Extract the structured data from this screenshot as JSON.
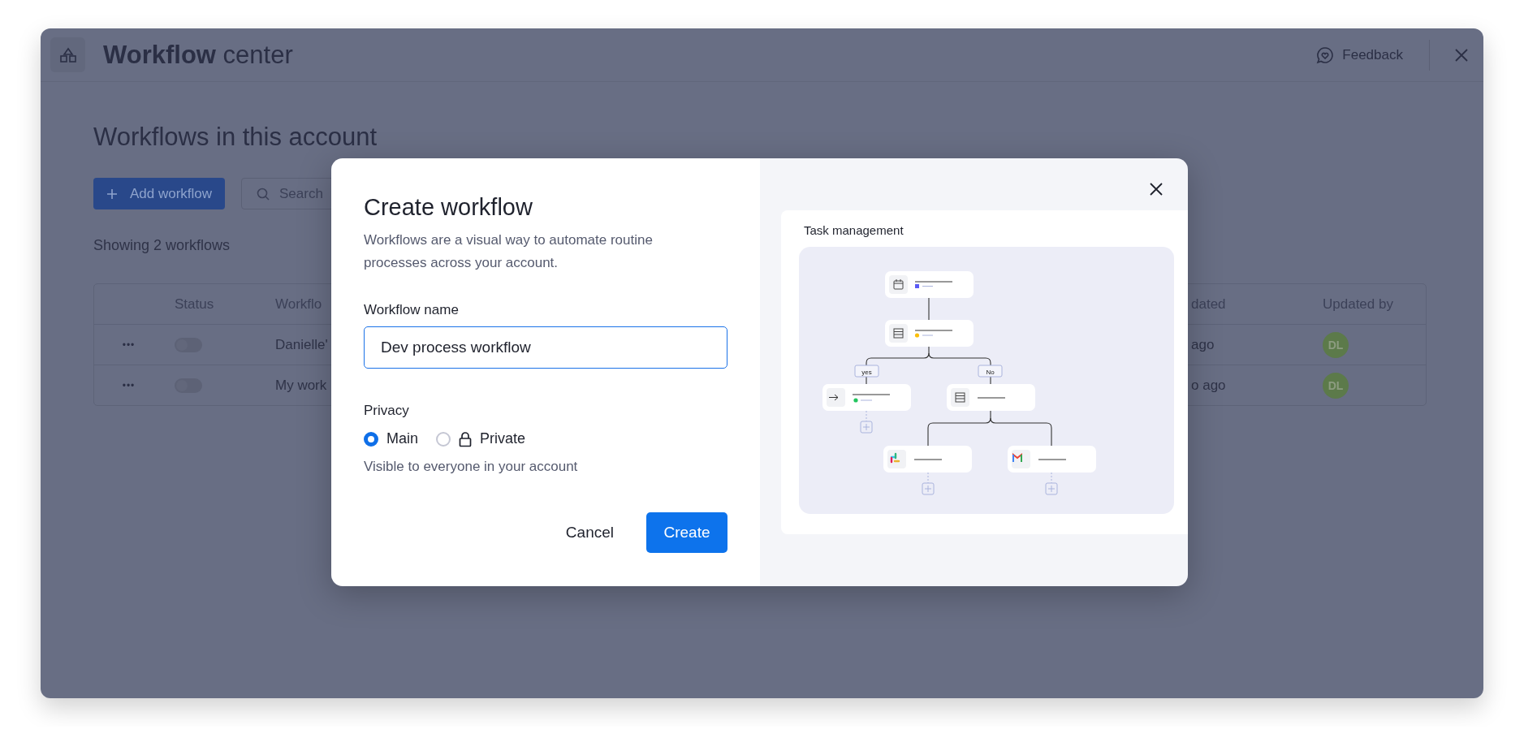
{
  "app": {
    "title": "**Workflow** center",
    "feedback": "Feedback"
  },
  "page": {
    "heading": "Workflows in this account",
    "add_button": "Add workflow",
    "search_placeholder": "Search",
    "count": "Showing 2 workflows"
  },
  "table": {
    "columns": [
      "",
      "Status",
      "Workflo",
      "dated",
      "Updated by"
    ],
    "rows": [
      {
        "menu": "•••",
        "on": false,
        "name": "Danielle'",
        "updated": "ago",
        "updated_by": "DL"
      },
      {
        "menu": "•••",
        "on": false,
        "name": "My work",
        "updated": "o ago",
        "updated_by": "DL"
      }
    ]
  },
  "modal": {
    "title": "Create workflow",
    "description": "Workflows are a visual way to automate routine processes across your account.",
    "name_label": "Workflow name",
    "name_value": "Dev process workflow",
    "privacy_label": "Privacy",
    "privacy_options": [
      {
        "label": "Main",
        "kind": "plain",
        "selected": true
      },
      {
        "label": "Private",
        "kind": "locked",
        "selected": false
      }
    ],
    "privacy_hint": "Visible to everyone in your account",
    "buttons": [
      {
        "label": "Cancel",
        "kind": "secondary"
      },
      {
        "label": "Create",
        "kind": "primary"
      }
    ],
    "preview": {
      "title": "Task management",
      "branch_labels": [
        "yes",
        "No"
      ]
    }
  }
}
